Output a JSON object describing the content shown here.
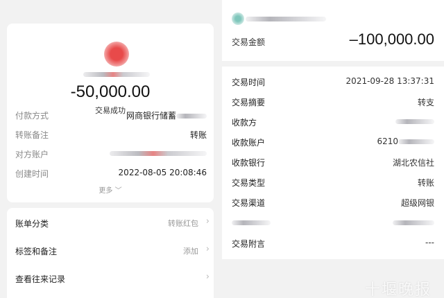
{
  "left": {
    "amount": "-50,000.00",
    "status": "交易成功",
    "details": [
      {
        "label": "付款方式",
        "value": "网商银行储蓄"
      },
      {
        "label": "转账备注",
        "value": "转账"
      },
      {
        "label": "对方账户",
        "value": ""
      },
      {
        "label": "创建时间",
        "value": "2022-08-05 20:08:46"
      }
    ],
    "more": "更多",
    "options": [
      {
        "label": "账单分类",
        "value": "转账红包"
      },
      {
        "label": "标签和备注",
        "value": "添加"
      },
      {
        "label": "查看往来记录",
        "value": ""
      }
    ]
  },
  "right": {
    "amount_label": "交易金额",
    "amount": "–100,000.00",
    "details": [
      {
        "label": "交易时间",
        "value": "2021-09-28 13:37:31"
      },
      {
        "label": "交易摘要",
        "value": "转支"
      },
      {
        "label": "收款方",
        "value": ""
      },
      {
        "label": "收款账户",
        "value": "6210"
      },
      {
        "label": "收款银行",
        "value": "湖北农信社"
      },
      {
        "label": "交易类型",
        "value": "转账"
      },
      {
        "label": "交易渠道",
        "value": "超级网银"
      },
      {
        "label": "",
        "value": ""
      },
      {
        "label": "交易附言",
        "value": "---"
      }
    ]
  },
  "watermark": "十堰晚报",
  "icons": {
    "chevron": "chevron-right-icon",
    "more": "chevron-down-icon"
  }
}
